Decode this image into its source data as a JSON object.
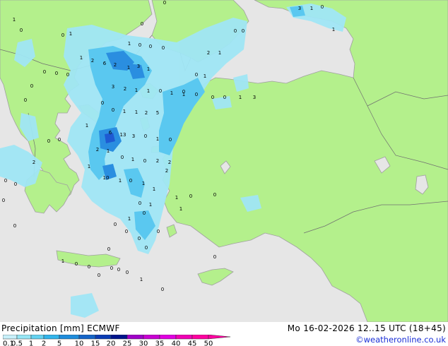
{
  "footer": {
    "title": "Precipitation [mm]  ECMWF",
    "datetime": "Mo 16-02-2026 12..15 UTC (18+45)",
    "credit": "©weatheronline.co.uk"
  },
  "legend": {
    "ticks": [
      "0.1",
      "0.5",
      "1",
      "2",
      "5",
      "10",
      "15",
      "20",
      "25",
      "30",
      "35",
      "40",
      "45",
      "50"
    ],
    "colors": [
      "#fefefe",
      "#c8f0fa",
      "#96e6f5",
      "#64d2f0",
      "#32b4eb",
      "#1e8cdc",
      "#1464c8",
      "#0a3cb4",
      "#00148c",
      "#a000c8",
      "#c800d2",
      "#e100e1",
      "#f000b4",
      "#ff00a0"
    ]
  },
  "map": {
    "colors": {
      "sea": "#e6e6e6",
      "land": "#b4f08c",
      "precip_light": "#a0e6f5",
      "precip_medium": "#5ac8f0",
      "precip_heavy": "#2a8ee0",
      "precip_strong": "#1e5ad2",
      "coast": "#a0a0a0"
    },
    "values": [
      {
        "v": "3"
      },
      {
        "v": "1"
      },
      {
        "v": "0"
      },
      {
        "v": "1"
      },
      {
        "v": "0"
      },
      {
        "v": "0"
      },
      {
        "v": "0"
      },
      {
        "v": "0"
      },
      {
        "v": "1"
      },
      {
        "v": "0"
      },
      {
        "v": "1"
      },
      {
        "v": "0"
      },
      {
        "v": "0"
      },
      {
        "v": "0"
      },
      {
        "v": "1"
      },
      {
        "v": "2"
      },
      {
        "v": "6"
      },
      {
        "v": "2"
      },
      {
        "v": "1"
      },
      {
        "v": "1"
      },
      {
        "v": "2"
      },
      {
        "v": "1"
      },
      {
        "v": "0"
      },
      {
        "v": "0"
      },
      {
        "v": "0"
      },
      {
        "v": "3"
      },
      {
        "v": "0"
      },
      {
        "v": "0"
      },
      {
        "v": "3"
      },
      {
        "v": "2"
      },
      {
        "v": "1"
      },
      {
        "v": "1"
      },
      {
        "v": "0"
      },
      {
        "v": "1"
      },
      {
        "v": "0"
      },
      {
        "v": "0"
      },
      {
        "v": "0"
      },
      {
        "v": "1"
      },
      {
        "v": "1"
      },
      {
        "v": "2"
      },
      {
        "v": "5"
      },
      {
        "v": "0"
      },
      {
        "v": "1"
      },
      {
        "v": "0"
      },
      {
        "v": "0"
      },
      {
        "v": "6"
      },
      {
        "v": "13"
      },
      {
        "v": "3"
      },
      {
        "v": "0"
      },
      {
        "v": "1"
      },
      {
        "v": "0"
      },
      {
        "v": "2"
      },
      {
        "v": "1"
      },
      {
        "v": "0"
      },
      {
        "v": "1"
      },
      {
        "v": "0"
      },
      {
        "v": "2"
      },
      {
        "v": "2"
      },
      {
        "v": "1"
      },
      {
        "v": "10"
      },
      {
        "v": "1"
      },
      {
        "v": "0"
      },
      {
        "v": "1"
      },
      {
        "v": "0"
      },
      {
        "v": "0"
      },
      {
        "v": "2"
      },
      {
        "v": "1"
      },
      {
        "v": "1"
      },
      {
        "v": "0"
      },
      {
        "v": "0"
      },
      {
        "v": "0"
      },
      {
        "v": "0"
      },
      {
        "v": "0"
      },
      {
        "v": "1"
      },
      {
        "v": "0"
      },
      {
        "v": "0"
      },
      {
        "v": "0"
      },
      {
        "v": "0"
      },
      {
        "v": "0"
      },
      {
        "v": "0"
      },
      {
        "v": "0"
      },
      {
        "v": "0"
      },
      {
        "v": "1"
      },
      {
        "v": "0"
      },
      {
        "v": "1"
      },
      {
        "v": "0"
      },
      {
        "v": "0"
      },
      {
        "v": "0"
      },
      {
        "v": "0"
      },
      {
        "v": "1"
      },
      {
        "v": "0"
      },
      {
        "v": "1"
      },
      {
        "v": "0"
      },
      {
        "v": "0"
      },
      {
        "v": "1"
      },
      {
        "v": "3"
      },
      {
        "v": "1"
      },
      {
        "v": "0"
      },
      {
        "v": "1"
      },
      {
        "v": "0"
      },
      {
        "v": "0"
      },
      {
        "v": "2"
      },
      {
        "v": "1"
      }
    ]
  }
}
